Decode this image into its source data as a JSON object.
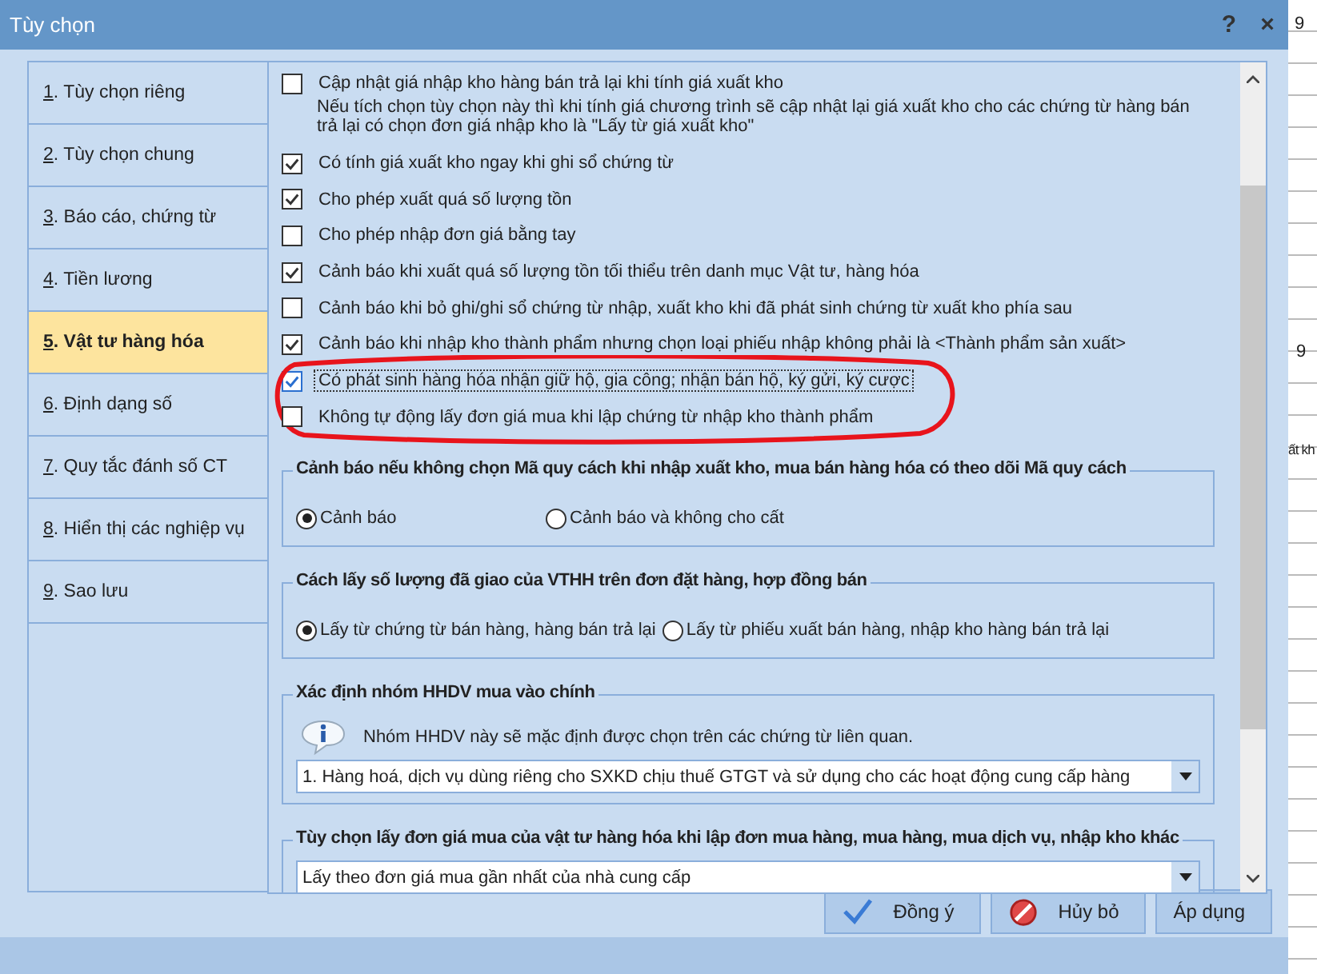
{
  "window": {
    "title": "Tùy chọn",
    "help": "?",
    "close": "×"
  },
  "background_texts": [
    "9",
    "9",
    "ất kh"
  ],
  "sidebar": {
    "items": [
      {
        "number": "1",
        "label": ". Tùy chọn riêng",
        "selected": false
      },
      {
        "number": "2",
        "label": ". Tùy chọn chung",
        "selected": false
      },
      {
        "number": "3",
        "label": ". Báo cáo, chứng từ",
        "selected": false
      },
      {
        "number": "4",
        "label": ". Tiền lương",
        "selected": false
      },
      {
        "number": "5",
        "label": ". Vật tư hàng hóa",
        "selected": true
      },
      {
        "number": "6",
        "label": ". Định dạng số",
        "selected": false
      },
      {
        "number": "7",
        "label": ". Quy tắc đánh số CT",
        "selected": false
      },
      {
        "number": "8",
        "label": ". Hiển thị các nghiệp vụ",
        "selected": false
      },
      {
        "number": "9",
        "label": ". Sao lưu",
        "selected": false
      }
    ]
  },
  "options": [
    {
      "label": "Cập nhật giá nhập kho hàng bán trả lại khi tính giá xuất kho",
      "checked": false,
      "focused": false,
      "description": "Nếu tích chọn tùy chọn này thì khi tính giá chương trình sẽ cập nhật lại giá xuất kho cho các chứng từ hàng bán trả lại có chọn đơn giá nhập kho là \"Lấy từ giá xuất kho\""
    },
    {
      "label": "Có tính giá xuất kho ngay khi ghi sổ chứng từ",
      "checked": true,
      "focused": false
    },
    {
      "label": "Cho phép xuất quá số lượng tồn",
      "checked": true,
      "focused": false
    },
    {
      "label": "Cho phép nhập đơn giá bằng tay",
      "checked": false,
      "focused": false
    },
    {
      "label": "Cảnh báo khi xuất quá số lượng tồn tối thiểu trên danh mục Vật tư, hàng hóa",
      "checked": true,
      "focused": false
    },
    {
      "label": "Cảnh báo khi bỏ ghi/ghi sổ chứng từ nhập, xuất kho khi đã phát sinh chứng từ xuất kho phía sau",
      "checked": false,
      "focused": false
    },
    {
      "label": "Cảnh báo khi nhập kho thành phẩm nhưng chọn loại phiếu nhập không phải là <Thành phẩm sản xuất>",
      "checked": true,
      "focused": false
    },
    {
      "label": "Có phát sinh hàng hóa nhận giữ hộ, gia công; nhận bán hộ, ký gửi, ký cược",
      "checked": true,
      "focused": true
    },
    {
      "label": "Không tự động lấy đơn giá mua khi lập chứng từ nhập kho thành phẩm",
      "checked": false,
      "focused": false
    }
  ],
  "groups": [
    {
      "kind": "radio",
      "title": "Cảnh báo nếu không chọn Mã quy cách khi nhập xuất kho, mua bán hàng hóa có theo dõi Mã quy cách",
      "choices": [
        {
          "label": "Cảnh báo",
          "selected": true
        },
        {
          "label": "Cảnh báo và không cho cất",
          "selected": false
        }
      ]
    },
    {
      "kind": "radio",
      "title": "Cách lấy số lượng đã giao của VTHH trên đơn đặt hàng, hợp đồng bán",
      "choices": [
        {
          "label": "Lấy từ chứng từ bán hàng, hàng bán trả lại",
          "selected": true
        },
        {
          "label": "Lấy từ phiếu xuất bán hàng, nhập kho hàng bán trả lại",
          "selected": false
        }
      ]
    },
    {
      "kind": "select",
      "title": "Xác định nhóm HHDV mua vào chính",
      "info": "Nhóm HHDV này sẽ mặc định được chọn trên các chứng từ liên quan.",
      "value": "1. Hàng hoá, dịch vụ dùng riêng cho SXKD chịu thuế GTGT và sử dụng cho các hoạt động cung cấp hàng"
    },
    {
      "kind": "select",
      "title": "Tùy chọn lấy đơn giá mua của vật tư hàng hóa khi lập đơn mua hàng, mua hàng, mua dịch vụ, nhập kho khác",
      "value": "Lấy theo đơn giá mua gần nhất của nhà cung cấp"
    }
  ],
  "buttons": [
    {
      "kind": "ok",
      "label": "Đồng ý"
    },
    {
      "kind": "cancel",
      "label": "Hủy bỏ"
    },
    {
      "kind": "apply",
      "label": "Áp dụng"
    }
  ]
}
